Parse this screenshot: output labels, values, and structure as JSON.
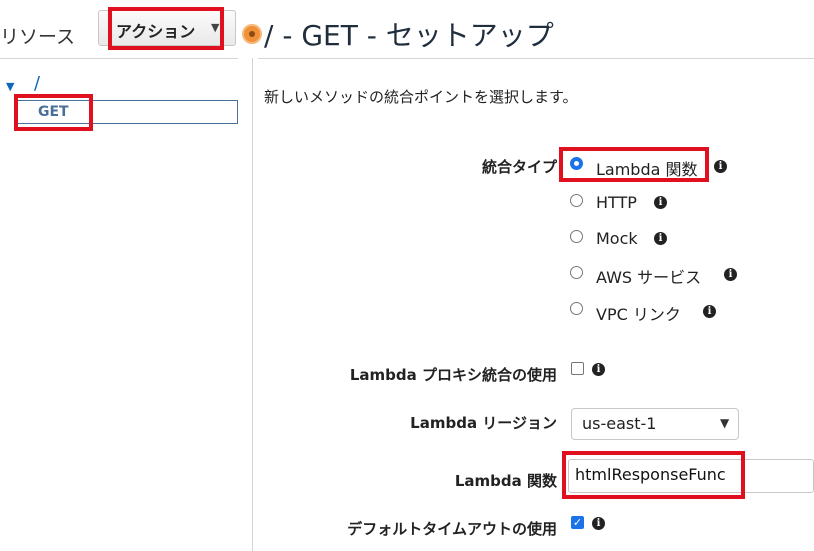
{
  "sidebar": {
    "title": "リソース",
    "actions_label": "アクション",
    "tree_root": "/",
    "selected_method": "GET"
  },
  "main": {
    "title": "/ - GET - セットアップ",
    "description": "新しいメソッドの統合ポイントを選択します。",
    "integration_type": {
      "label": "統合タイプ",
      "options": [
        {
          "label": "Lambda 関数",
          "selected": true
        },
        {
          "label": "HTTP",
          "selected": false
        },
        {
          "label": "Mock",
          "selected": false
        },
        {
          "label": "AWS サービス",
          "selected": false
        },
        {
          "label": "VPC リンク",
          "selected": false
        }
      ]
    },
    "proxy": {
      "label": "Lambda プロキシ統合の使用",
      "checked": false
    },
    "region": {
      "label": "Lambda リージョン",
      "value": "us-east-1"
    },
    "function": {
      "label": "Lambda 関数",
      "value": "htmlResponseFunc"
    },
    "default_timeout": {
      "label": "デフォルトタイムアウトの使用",
      "checked": true
    }
  },
  "icons": {
    "info": "info-icon",
    "caret": "caret-down-icon",
    "chevron": "chevron-down-icon"
  },
  "colors": {
    "highlight": "#e0101e",
    "accent": "#1a73e8",
    "orange": "#f0913a"
  }
}
